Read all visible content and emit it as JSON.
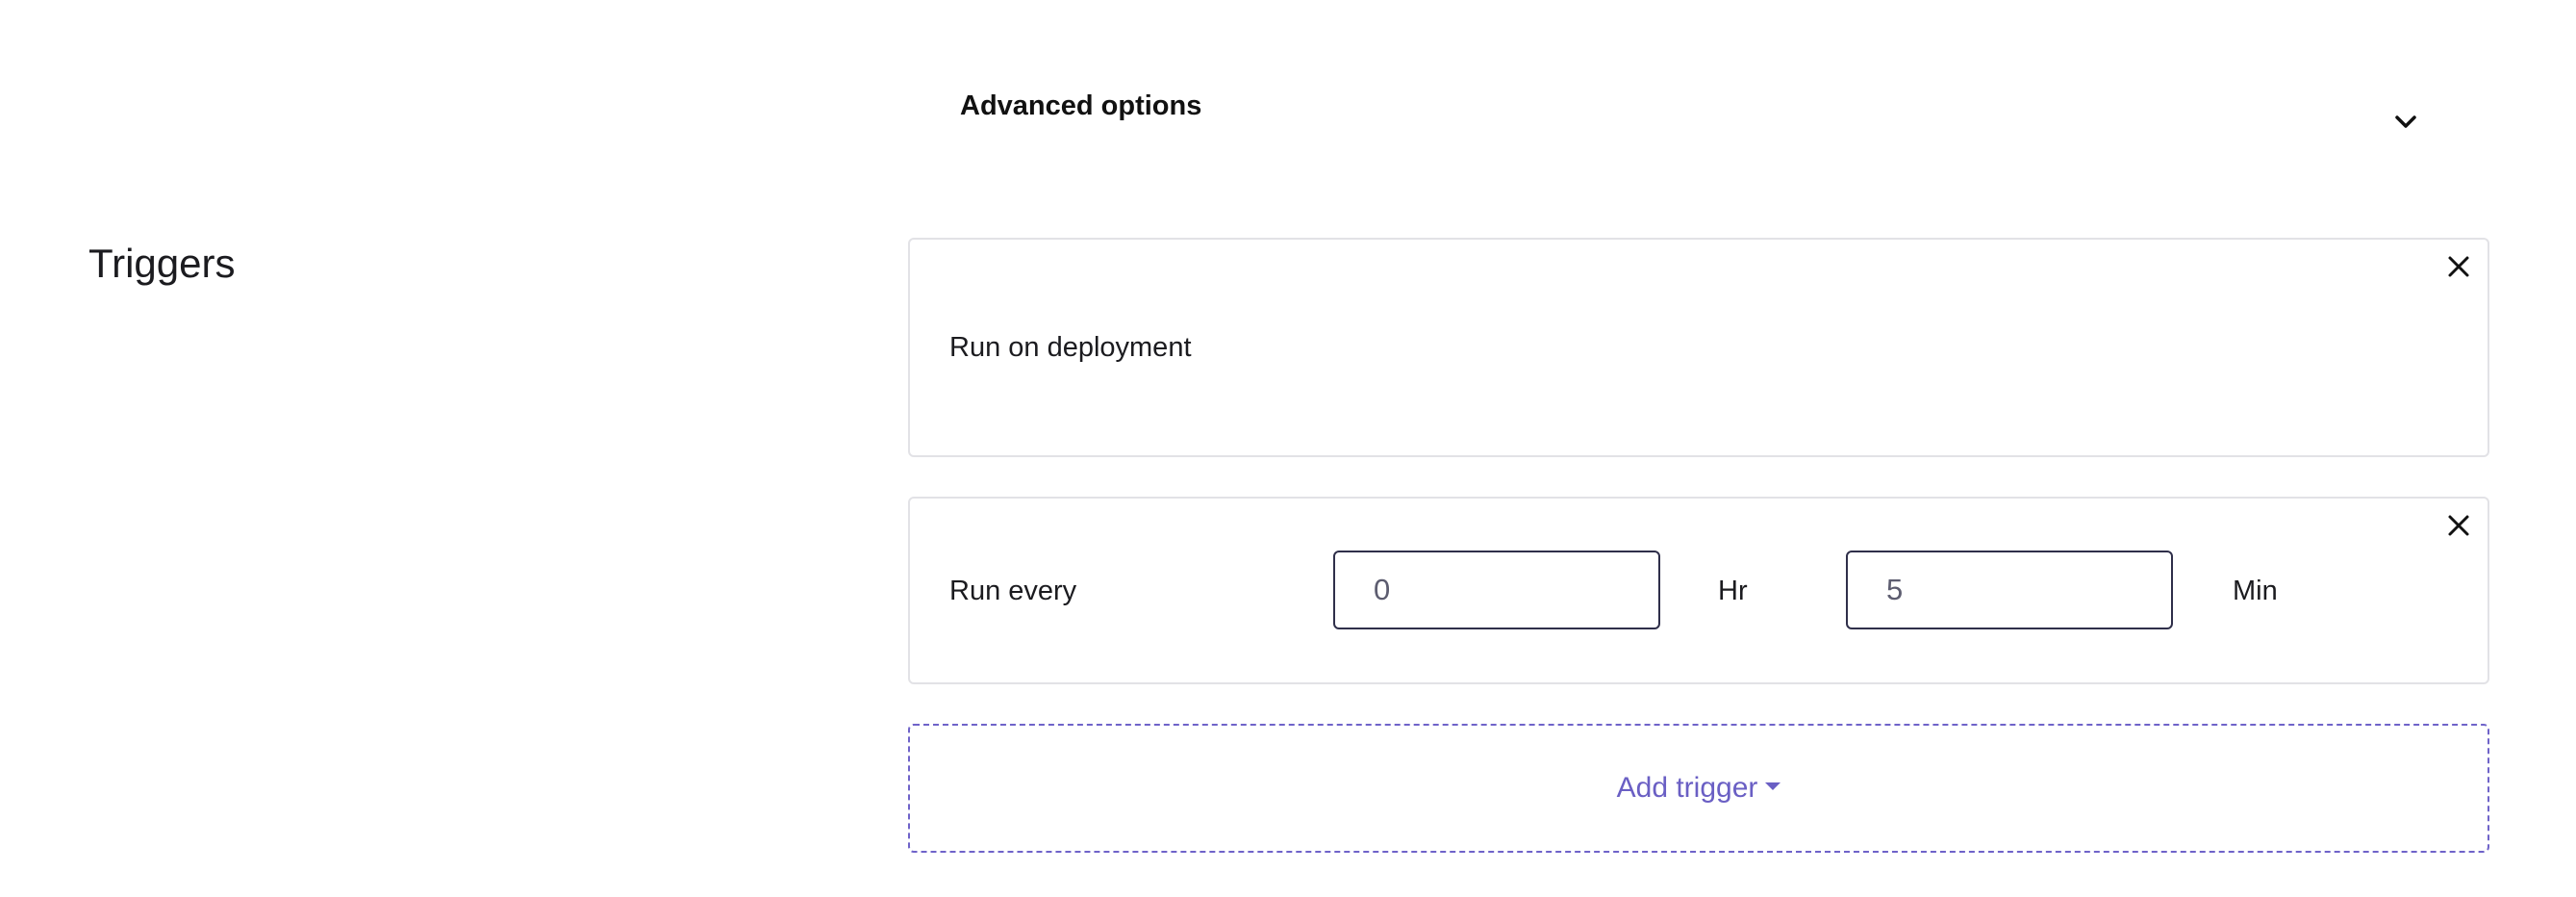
{
  "advanced_options": {
    "label": "Advanced options",
    "icon": "chevron-down-icon"
  },
  "triggers": {
    "title": "Triggers",
    "deployment_trigger": {
      "label": "Run on deployment",
      "close_icon": "close-icon"
    },
    "schedule_trigger": {
      "label": "Run every",
      "hours_value": "0",
      "hours_unit": "Hr",
      "minutes_value": "5",
      "minutes_unit": "Min",
      "close_icon": "close-icon"
    },
    "add_trigger": {
      "label": "Add trigger",
      "icon": "caret-down-icon",
      "accent_color": "#6a5fc4"
    }
  }
}
